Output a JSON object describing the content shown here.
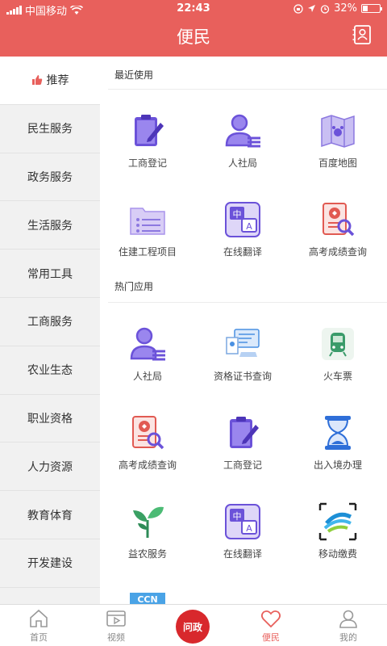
{
  "status": {
    "carrier": "中国移动",
    "time": "22:43",
    "battery": "32%",
    "battery_level": 0.32
  },
  "header": {
    "title": "便民"
  },
  "sidebar": {
    "items": [
      {
        "label": "推荐"
      },
      {
        "label": "民生服务"
      },
      {
        "label": "政务服务"
      },
      {
        "label": "生活服务"
      },
      {
        "label": "常用工具"
      },
      {
        "label": "工商服务"
      },
      {
        "label": "农业生态"
      },
      {
        "label": "职业资格"
      },
      {
        "label": "人力资源"
      },
      {
        "label": "教育体育"
      },
      {
        "label": "开发建设"
      }
    ]
  },
  "main": {
    "recent_title": "最近使用",
    "hot_title": "热门应用",
    "recent": [
      {
        "label": "工商登记",
        "icon": "clipboard-pen-icon"
      },
      {
        "label": "人社局",
        "icon": "person-list-icon"
      },
      {
        "label": "百度地图",
        "icon": "map-icon"
      },
      {
        "label": "住建工程项目",
        "icon": "folder-list-icon"
      },
      {
        "label": "在线翻译",
        "icon": "translate-icon"
      },
      {
        "label": "高考成绩查询",
        "icon": "certificate-search-icon"
      }
    ],
    "hot": [
      {
        "label": "人社局",
        "icon": "person-list-icon"
      },
      {
        "label": "资格证书查询",
        "icon": "certificate-computer-icon"
      },
      {
        "label": "火车票",
        "icon": "train-icon"
      },
      {
        "label": "高考成绩查询",
        "icon": "certificate-search-icon"
      },
      {
        "label": "工商登记",
        "icon": "clipboard-pen-icon"
      },
      {
        "label": "出入境办理",
        "icon": "hourglass-icon"
      },
      {
        "label": "益农服务",
        "icon": "sprout-icon"
      },
      {
        "label": "在线翻译",
        "icon": "translate-icon"
      },
      {
        "label": "移动缴费",
        "icon": "china-mobile-icon"
      }
    ]
  },
  "tabbar": {
    "items": [
      {
        "label": "首页"
      },
      {
        "label": "视频"
      },
      {
        "label": "问政"
      },
      {
        "label": "便民"
      },
      {
        "label": "我的"
      }
    ]
  },
  "colors": {
    "brand": "#e8605c",
    "sidebar_bg": "#f1f1f1",
    "icon_purple": "#6b52d9"
  }
}
